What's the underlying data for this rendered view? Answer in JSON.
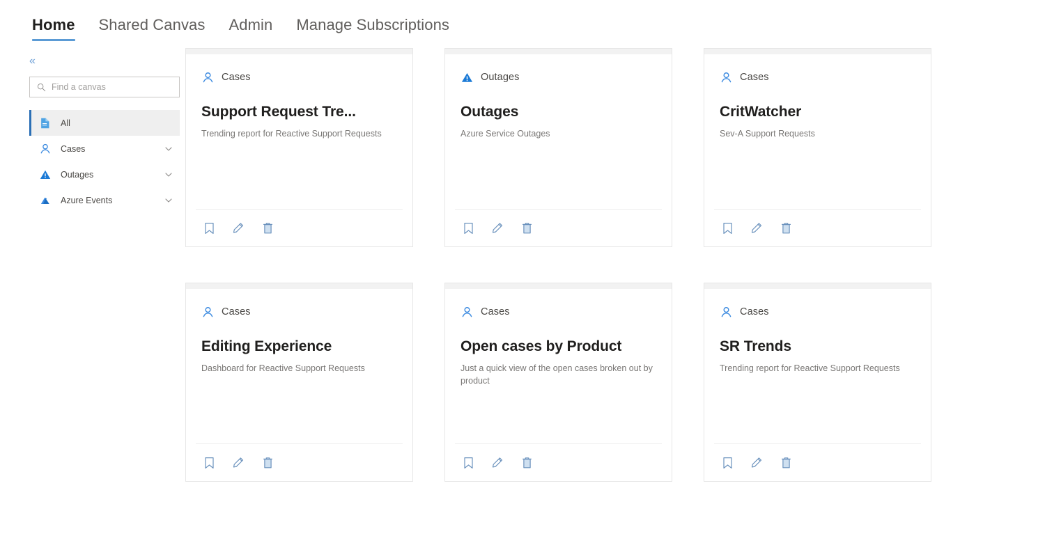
{
  "topnav": {
    "tabs": [
      {
        "label": "Home",
        "active": true
      },
      {
        "label": "Shared Canvas",
        "active": false
      },
      {
        "label": "Admin",
        "active": false
      },
      {
        "label": "Manage Subscriptions",
        "active": false
      }
    ]
  },
  "sidebar": {
    "collapse_glyph": "«",
    "search": {
      "placeholder": "Find a canvas",
      "value": ""
    },
    "items": [
      {
        "label": "All",
        "icon": "document-icon",
        "selected": true,
        "expandable": false
      },
      {
        "label": "Cases",
        "icon": "person-icon",
        "selected": false,
        "expandable": true
      },
      {
        "label": "Outages",
        "icon": "warning-triangle-icon",
        "selected": false,
        "expandable": true
      },
      {
        "label": "Azure Events",
        "icon": "azure-icon",
        "selected": false,
        "expandable": true
      }
    ]
  },
  "cards": [
    {
      "category": "Cases",
      "category_icon": "person-icon",
      "title": "Support Request Tre...",
      "description": "Trending report for Reactive Support Requests"
    },
    {
      "category": "Outages",
      "category_icon": "warning-triangle-icon",
      "title": "Outages",
      "description": "Azure Service Outages"
    },
    {
      "category": "Cases",
      "category_icon": "person-icon",
      "title": "CritWatcher",
      "description": "Sev-A Support Requests"
    },
    {
      "category": "Cases",
      "category_icon": "person-icon",
      "title": "Editing Experience",
      "description": "Dashboard for Reactive Support Requests"
    },
    {
      "category": "Cases",
      "category_icon": "person-icon",
      "title": "Open cases by Product",
      "description": "Just a quick view of the open cases broken out by product"
    },
    {
      "category": "Cases",
      "category_icon": "person-icon",
      "title": "SR Trends",
      "description": "Trending report for Reactive Support Requests"
    }
  ],
  "card_actions": [
    {
      "name": "bookmark-icon",
      "label": "Bookmark"
    },
    {
      "name": "pencil-icon",
      "label": "Edit"
    },
    {
      "name": "trash-icon",
      "label": "Delete"
    }
  ],
  "colors": {
    "accent": "#2b6fb5",
    "icon_blue": "#3b8ae0",
    "active_underline": "#5b9bd5",
    "card_strip": "#f2f2f2",
    "muted_text": "#797775"
  }
}
